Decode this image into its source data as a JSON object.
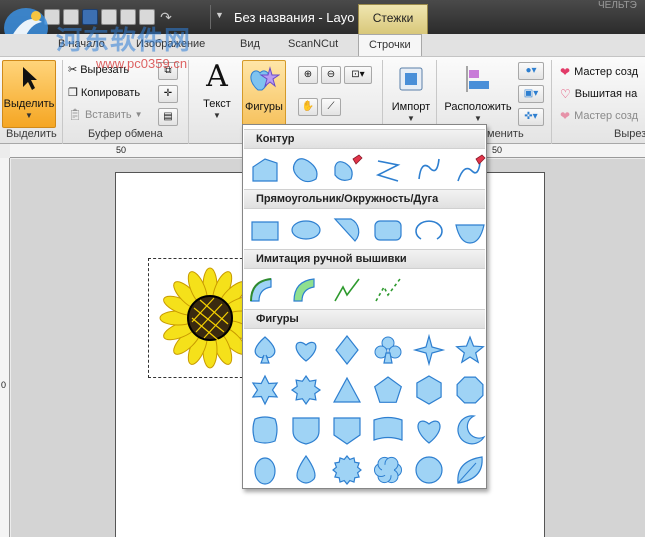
{
  "title_bar": {
    "document_title": "Без названия - Layo",
    "context_tab": "Стежки",
    "corner_text": "ЧЕЛЬТЭ"
  },
  "watermark": {
    "site_name": "河东软件网",
    "url": "www.pc0359.cn"
  },
  "tabs": [
    "В начало",
    "Изображение",
    "Вид",
    "ScanNCut",
    "Строчки"
  ],
  "ribbon": {
    "select": {
      "label": "Выделить",
      "group": "Выделить"
    },
    "clipboard": {
      "cut": "Вырезать",
      "copy": "Копировать",
      "paste": "Вставить",
      "group": "Буфер обмена"
    },
    "text": {
      "label": "Текст"
    },
    "shapes": {
      "label": "Фигуры"
    },
    "import": {
      "label": "Импорт"
    },
    "arrange": {
      "label": "Расположить",
      "group": "менить"
    },
    "wizards": {
      "items": [
        "Мастер созд",
        "Вышитая на",
        "Мастер созд"
      ],
      "group": "Вырез"
    }
  },
  "ruler": {
    "top_mark": "50",
    "page_mark": "50",
    "left_mark": "0"
  },
  "shapes_menu": {
    "sections": [
      {
        "title": "Контур",
        "shapes": [
          "polygon-outline",
          "closed-curve",
          "pen-freehand",
          "zigzag-line",
          "s-curve",
          "pen-line"
        ]
      },
      {
        "title": "Прямоугольник/Окружность/Дуга",
        "shapes": [
          "rectangle",
          "ellipse",
          "sector",
          "rounded-rectangle",
          "arc",
          "half-ellipse"
        ]
      },
      {
        "title": "Имитация ручной вышивки",
        "shapes": [
          "thick-stitch-arc",
          "satin-stitch-arc",
          "running-stitch-line",
          "dashed-stitch-line"
        ]
      },
      {
        "title": "Фигуры",
        "shapes": [
          "spade",
          "heart-outline",
          "diamond",
          "club",
          "four-point-star",
          "five-point-star",
          "six-point-star",
          "eight-point-star",
          "triangle",
          "pentagon",
          "hexagon",
          "octagon",
          "scalloped-square",
          "shield",
          "pentagon-badge",
          "banner",
          "heart",
          "crescent-moon",
          "egg",
          "teardrop",
          "seal",
          "flower",
          "circle",
          "leaf"
        ]
      }
    ]
  },
  "colors": {
    "shape_fill": "#9fd3f5",
    "shape_stroke": "#2e7fd0",
    "title_bar": "#3a3a3a",
    "select_button": "#f5a623",
    "watermark_blue": "#2f7fd8",
    "watermark_red": "#d43030"
  }
}
